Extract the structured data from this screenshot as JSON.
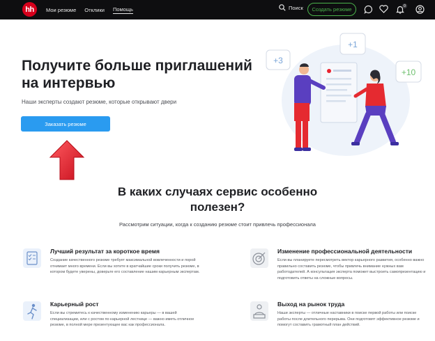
{
  "header": {
    "logo": "hh",
    "nav": [
      "Мои резюме",
      "Отклики",
      "Помощь"
    ],
    "active_nav": "Помощь",
    "search_label": "Поиск",
    "create_resume_label": "Создать резюме",
    "notifications_count": "0"
  },
  "hero": {
    "title": "Получите больше приглашений на интервью",
    "subtitle": "Наши эксперты создают резюме, которые открывают двери",
    "order_button": "Заказать резюме",
    "badges": [
      "+3",
      "+1",
      "+10"
    ]
  },
  "section": {
    "title": "В каких случаях сервис особенно полезен?",
    "subtitle": "Рассмотрим ситуации, когда к созданию резюме стоит привлечь профессионала",
    "cards": [
      {
        "title": "Лучший результат за короткое время",
        "text": "Создание качественного резюме требует максимальной вовлеченности и порой отнимает много времени. Если вы хотите в кратчайшие сроки получить резюме, в котором будете уверены, доверьте его составление нашим карьерным экспертам.",
        "icon": "checklist-icon"
      },
      {
        "title": "Изменение профессиональной деятельности",
        "text": "Если вы планируете пересмотреть вектор карьерного развития, особенно важно правильно составить резюме, чтобы привлечь внимание нужных вам работодателей. А консультация эксперта поможет выстроить самопрезентацию и подготовить ответы на сложные вопросы.",
        "icon": "target-icon"
      },
      {
        "title": "Карьерный рост",
        "text": "Если вы стремитесь к качественному изменению карьеры — в вашей специализации, или с ростом по карьерной лестнице — важно иметь отличное резюме, в полной мере презентующее вас как профессионала.",
        "icon": "running-person-icon"
      },
      {
        "title": "Выход на рынок труда",
        "text": "Наши эксперты — отличные наставники в поиске первой работы или поиске работы после длительного перерыва. Они подготовят эффективное резюме и помогут составить грамотный план действий.",
        "icon": "person-desk-icon"
      }
    ]
  },
  "colors": {
    "header_bg": "#0e0e10",
    "brand_red": "#d6001c",
    "accent_green": "#4bb34b",
    "button_blue": "#2a9bf0",
    "arrow_red": "#e8222e"
  }
}
